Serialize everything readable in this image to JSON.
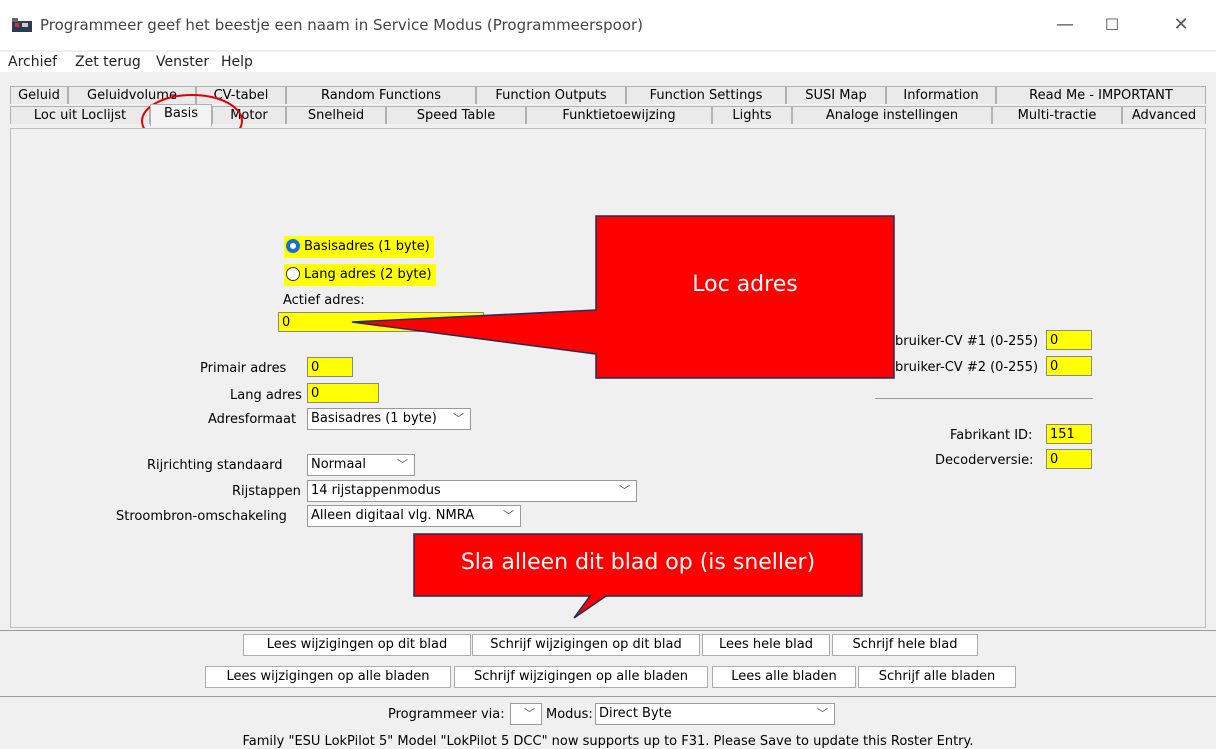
{
  "window": {
    "title": "Programmeer geef het beestje een naam in Service Modus (Programmeerspoor)",
    "minimize": "—",
    "maximize": "☐",
    "close": "✕"
  },
  "menu": [
    "Archief",
    "Zet terug",
    "Venster",
    "Help"
  ],
  "tabs_row1": [
    "Geluid",
    "Geluidvolume",
    "CV-tabel",
    "Random Functions",
    "Function Outputs",
    "Function Settings",
    "SUSI Map",
    "Information",
    "Read Me - IMPORTANT"
  ],
  "tabs_row2": [
    "Loc uit Loclijst",
    "Basis",
    "Motor",
    "Snelheid",
    "Speed Table",
    "Funktietoewijzing",
    "Lights",
    "Analoge instellingen",
    "Multi-tractie",
    "Advanced"
  ],
  "basis": {
    "radio_short": "Basisadres (1 byte)",
    "radio_long": "Lang adres (2 byte)",
    "actief_label": "Actief adres:",
    "actief_value": "0",
    "primair_label": "Primair adres",
    "primair_value": "0",
    "lang_label": "Lang adres",
    "lang_value": "0",
    "adresformaat_label": "Adresformaat",
    "adresformaat_value": "Basisadres (1 byte)",
    "rijrichting_label": "Rijrichting standaard",
    "rijrichting_value": "Normaal",
    "rijstappen_label": "Rijstappen",
    "rijstappen_value": "14 rijstappenmodus",
    "stroom_label": "Stroombron-omschakeling",
    "stroom_value": "Alleen digitaal vlg. NMRA",
    "cv1_label": "bruiker-CV #1 (0-255)",
    "cv1_value": "0",
    "cv2_label": "bruiker-CV #2 (0-255)",
    "cv2_value": "0",
    "fabrikant_label": "Fabrikant ID:",
    "fabrikant_value": "151",
    "decoder_label": "Decoderversie:",
    "decoder_value": "0"
  },
  "callouts": {
    "loc_adres": "Loc adres",
    "save_sheet": "Sla alleen dit blad op (is sneller)"
  },
  "buttons_row1": [
    "Lees wijzigingen op dit blad",
    "Schrijf wijzigingen op dit blad",
    "Lees hele blad",
    "Schrijf hele blad"
  ],
  "buttons_row2": [
    "Lees wijzigingen op alle bladen",
    "Schrijf wijzigingen op alle bladen",
    "Lees alle bladen",
    "Schrijf alle bladen"
  ],
  "programmer": {
    "via_label": "Programmeer via:",
    "via_value": "",
    "modus_label": "Modus:",
    "modus_value": "Direct Byte"
  },
  "status": "Family \"ESU LokPilot 5\" Model \"LokPilot 5 DCC\" now supports up to F31. Please Save to update this Roster Entry.",
  "colors": {
    "field_bg": "#ffff00",
    "callout_red": "#ff0000",
    "radio_accent": "#1a6ed8"
  }
}
